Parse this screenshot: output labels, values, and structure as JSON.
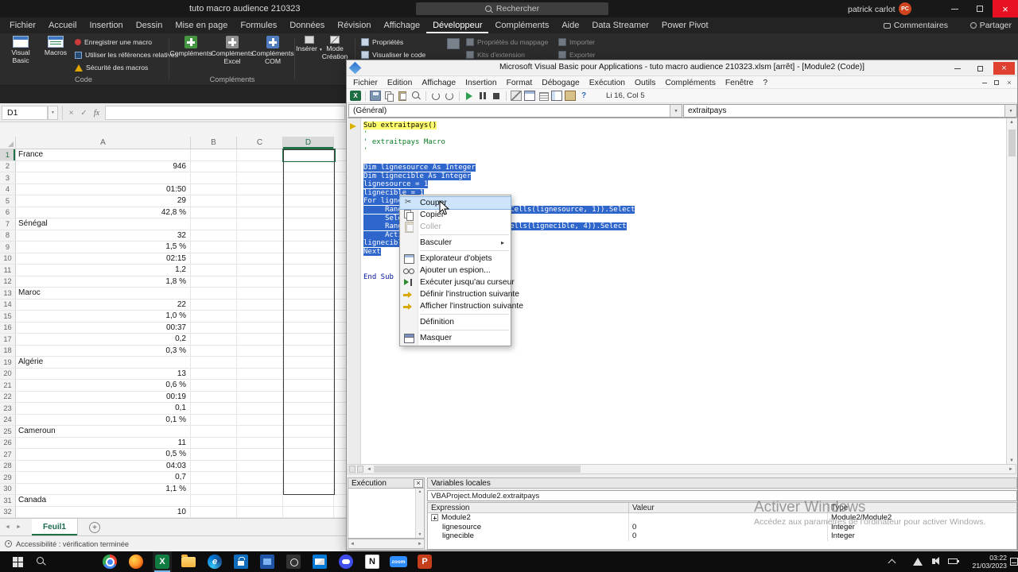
{
  "window": {
    "title": "tuto macro audience 210323",
    "search_placeholder": "Rechercher",
    "user": "patrick carlot",
    "user_initials": "PC"
  },
  "ribbon": {
    "tabs": [
      "Fichier",
      "Accueil",
      "Insertion",
      "Dessin",
      "Mise en page",
      "Formules",
      "Données",
      "Révision",
      "Affichage",
      "Développeur",
      "Compléments",
      "Aide",
      "Data Streamer",
      "Power Pivot"
    ],
    "active_tab": "Développeur",
    "comments": "Commentaires",
    "share": "Partager",
    "code_group": {
      "visual_basic": "Visual Basic",
      "macros": "Macros",
      "record_macro": "Enregistrer une macro",
      "relative_refs": "Utiliser les références relatives",
      "macro_security": "Sécurité des macros",
      "label": "Code"
    },
    "addins_group": {
      "addins": "Compléments",
      "excel_addins": "Compléments Excel",
      "com_addins": "Compléments COM",
      "label": "Compléments"
    },
    "controls_group": {
      "insert": "Insérer",
      "design_mode": "Mode Création"
    },
    "right_buttons": {
      "properties": "Propriétés",
      "view_code": "Visualiser le code",
      "map_properties": "Propriétés du mappage",
      "expansion_packs": "Kits d'extension",
      "import": "Importer",
      "export": "Exporter"
    }
  },
  "formula_bar": {
    "name_box": "D1"
  },
  "sheet": {
    "columns": [
      "A",
      "B",
      "C",
      "D"
    ],
    "col_a": [
      "France",
      "946",
      "",
      "01:50",
      "29",
      "42,8 %",
      "Sénégal",
      "32",
      "1,5 %",
      "02:15",
      "1,2",
      "1,8 %",
      "Maroc",
      "22",
      "1,0 %",
      "00:37",
      "0,2",
      "0,3 %",
      "Algérie",
      "13",
      "0,6 %",
      "00:19",
      "0,1",
      "0,1 %",
      "Cameroun",
      "11",
      "0,5 %",
      "04:03",
      "0,7",
      "1,1 %",
      "Canada",
      "10"
    ]
  },
  "tabs_bar": {
    "sheet": "Feuil1"
  },
  "status": "Accessibilité : vérification terminée",
  "vba": {
    "title": "Microsoft Visual Basic pour Applications - tuto macro audience 210323.xlsm [arrêt] - [Module2 (Code)]",
    "menus": [
      "Fichier",
      "Edition",
      "Affichage",
      "Insertion",
      "Format",
      "Débogage",
      "Exécution",
      "Outils",
      "Compléments",
      "Fenêtre",
      "?"
    ],
    "toolbar_icons": [
      "excel",
      "|",
      "save",
      "copy",
      "paste",
      "find",
      "|",
      "undo",
      "redo",
      "|",
      "run",
      "break",
      "stop",
      "|",
      "design-mode",
      "project-explorer",
      "properties",
      "object-browser",
      "toolbox",
      "help"
    ],
    "caret_position": "Li 16, Col 5",
    "object_combo": "(Général)",
    "proc_combo": "extraitpays",
    "code": [
      {
        "t": "Sub extraitpays()",
        "s": "cur"
      },
      {
        "t": "'",
        "s": "cmt"
      },
      {
        "t": "' extraitpays Macro",
        "s": "cmt"
      },
      {
        "t": "'",
        "s": "cmt"
      },
      {
        "t": "",
        "s": ""
      },
      {
        "t": "Dim lignesource As Integer",
        "s": "sel"
      },
      {
        "t": "Dim lignecible As Integer",
        "s": "sel"
      },
      {
        "t": "lignesource = 1",
        "s": "sel"
      },
      {
        "t": "lignecible = 1",
        "s": "sel"
      },
      {
        "t": "For lignesource = 1 To 946",
        "s": "sel"
      },
      {
        "t": "     Range(Cells(lignesource, 1), Cells(lignesource, 1)).Select",
        "s": "sel"
      },
      {
        "t": "     Selection.Copy",
        "s": "sel"
      },
      {
        "t": "     Range(Cells(lignecible, 4), Cells(lignecible, 4)).Select",
        "s": "sel"
      },
      {
        "t": "     ActiveSheet.Paste",
        "s": "sel"
      },
      {
        "t": "lignecible = lignecible + 1",
        "s": "sel"
      },
      {
        "t": "Next",
        "s": "sel"
      },
      {
        "t": "",
        "s": ""
      },
      {
        "t": "",
        "s": ""
      },
      {
        "t": "End Sub",
        "s": "kw"
      }
    ],
    "immediate_title": "Exécution",
    "locals": {
      "title": "Variables locales",
      "context": "VBAProject.Module2.extraitpays",
      "columns": [
        "Expression",
        "Valeur",
        "Type"
      ],
      "rows": [
        {
          "expr": "Module2",
          "val": "",
          "type": "Module2/Module2",
          "expand": true
        },
        {
          "expr": "lignesource",
          "val": "0",
          "type": "Integer"
        },
        {
          "expr": "lignecible",
          "val": "0",
          "type": "Integer"
        }
      ]
    }
  },
  "context_menu": {
    "items": [
      {
        "label": "Couper",
        "icon": "cut",
        "hover": true
      },
      {
        "label": "Copier",
        "icon": "copy"
      },
      {
        "label": "Coller",
        "icon": "paste",
        "disabled": true
      },
      {
        "sep": true
      },
      {
        "label": "Basculer",
        "submenu": true
      },
      {
        "sep": true
      },
      {
        "label": "Explorateur d'objets",
        "icon": "object-browser"
      },
      {
        "label": "Ajouter un espion...",
        "icon": "watch"
      },
      {
        "label": "Exécuter jusqu'au curseur",
        "icon": "run-to-cursor"
      },
      {
        "label": "Définir l'instruction suivante",
        "icon": "set-next"
      },
      {
        "label": "Afficher l'instruction suivante",
        "icon": "show-next"
      },
      {
        "sep": true
      },
      {
        "label": "Définition"
      },
      {
        "sep": true
      },
      {
        "label": "Masquer",
        "icon": "hide"
      }
    ]
  },
  "watermark": {
    "line1": "Activer Windows",
    "line2": "Accédez aux paramètres de l'ordinateur pour activer Windows."
  },
  "taskbar": {
    "apps": [
      "chrome",
      "firefox",
      "excel",
      "explorer",
      "edge",
      "store",
      "photos",
      "camera",
      "mail",
      "discord",
      "notion",
      "zoom",
      "powerpoint"
    ],
    "active_app": "excel",
    "clock_time": "03:22",
    "clock_date": "21/03/2023"
  }
}
